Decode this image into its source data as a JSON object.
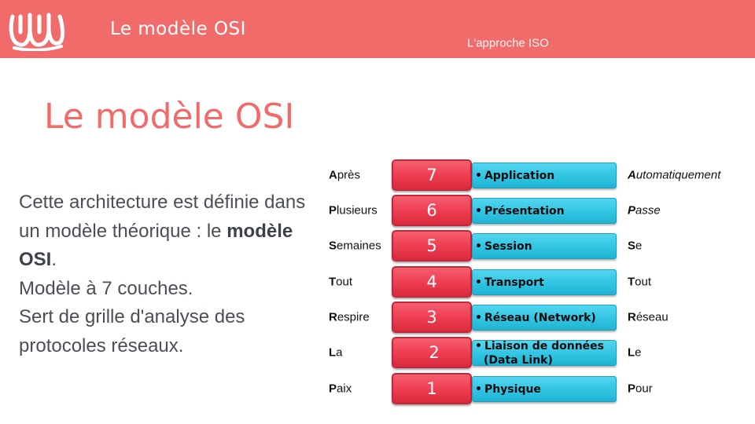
{
  "header": {
    "logo_icon": "squiggle-logo-icon",
    "title": "Le modèle OSI",
    "subtitle": "L'approche ISO",
    "bar_color": "#f26b6b"
  },
  "page": {
    "title": "Le modèle OSI",
    "body_line1_before": "Cette architecture est définie dans un modèle théorique : le ",
    "body_bold": "modèle OSI",
    "body_line1_after": ".",
    "body_line2": "Modèle à 7 couches.",
    "body_line3": "Sert de grille d'analyse des protocoles réseaux."
  },
  "osi_layers": [
    {
      "number": "7",
      "layer": "Application",
      "left_word_first": "A",
      "left_word_rest": "près",
      "right_word_first": "A",
      "right_word_rest": "utomatiquement",
      "right_italic": true
    },
    {
      "number": "6",
      "layer": "Présentation",
      "left_word_first": "P",
      "left_word_rest": "lusieurs",
      "right_word_first": "P",
      "right_word_rest": "asse",
      "right_italic": true
    },
    {
      "number": "5",
      "layer": "Session",
      "left_word_first": "S",
      "left_word_rest": "emaines",
      "right_word_first": "S",
      "right_word_rest": "e",
      "right_italic": false
    },
    {
      "number": "4",
      "layer": "Transport",
      "left_word_first": "T",
      "left_word_rest": "out",
      "right_word_first": "T",
      "right_word_rest": "out",
      "right_italic": false
    },
    {
      "number": "3",
      "layer": "Réseau (Network)",
      "left_word_first": "R",
      "left_word_rest": "espire",
      "right_word_first": "R",
      "right_word_rest": "éseau",
      "right_italic": false
    },
    {
      "number": "2",
      "layer": "Liaison de données",
      "layer_line2": "(Data Link)",
      "left_word_first": "L",
      "left_word_rest": "a",
      "right_word_first": "L",
      "right_word_rest": "e",
      "right_italic": false
    },
    {
      "number": "1",
      "layer": "Physique",
      "left_word_first": "P",
      "left_word_rest": "aix",
      "right_word_first": "P",
      "right_word_rest": "our",
      "right_italic": false
    }
  ],
  "bullet": "•"
}
